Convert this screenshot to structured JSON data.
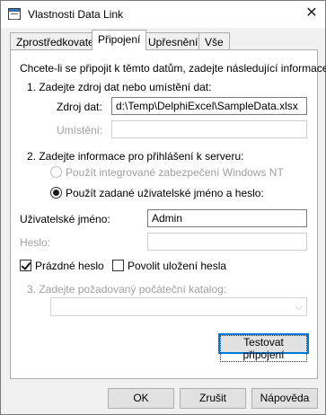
{
  "window": {
    "title": "Vlastnosti Data Link",
    "close_glyph": "✕"
  },
  "tabs": [
    {
      "label": "Zprostředkovatel"
    },
    {
      "label": "Připojení"
    },
    {
      "label": "Upřesnění"
    },
    {
      "label": "Vše"
    }
  ],
  "connection": {
    "intro": "Chcete-li se připojit k těmto datům, zadejte následující informace:",
    "step1": "1. Zadejte zdroj dat nebo umístění dat:",
    "source_label": "Zdroj dat:",
    "source_value": "d:\\Temp\\DelphiExcel\\SampleData.xlsx",
    "location_label": "Umístění:",
    "location_value": "",
    "step2": "2. Zadejte informace pro přihlášení k serveru:",
    "radio_integrated": "Použít integrované zabezpečení Windows NT",
    "radio_specific": "Použít zadané uživatelské jméno a heslo:",
    "username_label": "Uživatelské jméno:",
    "username_value": "Admin",
    "password_label": "Heslo:",
    "password_value": "",
    "blank_password": "Prázdné heslo",
    "allow_save": "Povolit uložení hesla",
    "step3": "3. Zadejte požadovaný počáteční katalog:",
    "catalog_value": "",
    "test_button": "Testovat připojení"
  },
  "footer": {
    "ok": "OK",
    "cancel": "Zrušit",
    "help": "Nápověda"
  }
}
